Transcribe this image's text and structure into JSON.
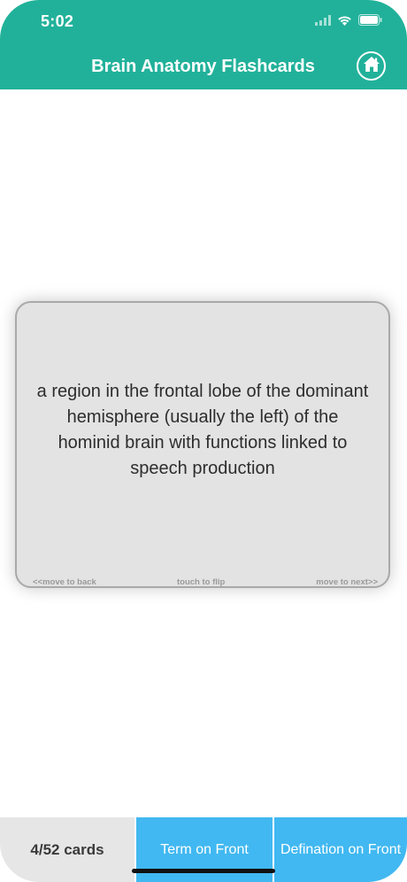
{
  "status": {
    "time": "5:02"
  },
  "nav": {
    "title": "Brain Anatomy Flashcards",
    "home_icon": "home-icon"
  },
  "card": {
    "text": "a region in the frontal lobe of the dominant hemisphere (usually the left) of the hominid brain with functions linked to speech production",
    "hint_back": "<<move to back",
    "hint_flip": "touch to flip",
    "hint_next": "move to next>>"
  },
  "bottom": {
    "count": "4/52 cards",
    "term_front": "Term on Front",
    "def_front": "Defination on Front"
  },
  "colors": {
    "header": "#21b19a",
    "segment": "#41b8f1",
    "card": "#e3e3e3"
  }
}
